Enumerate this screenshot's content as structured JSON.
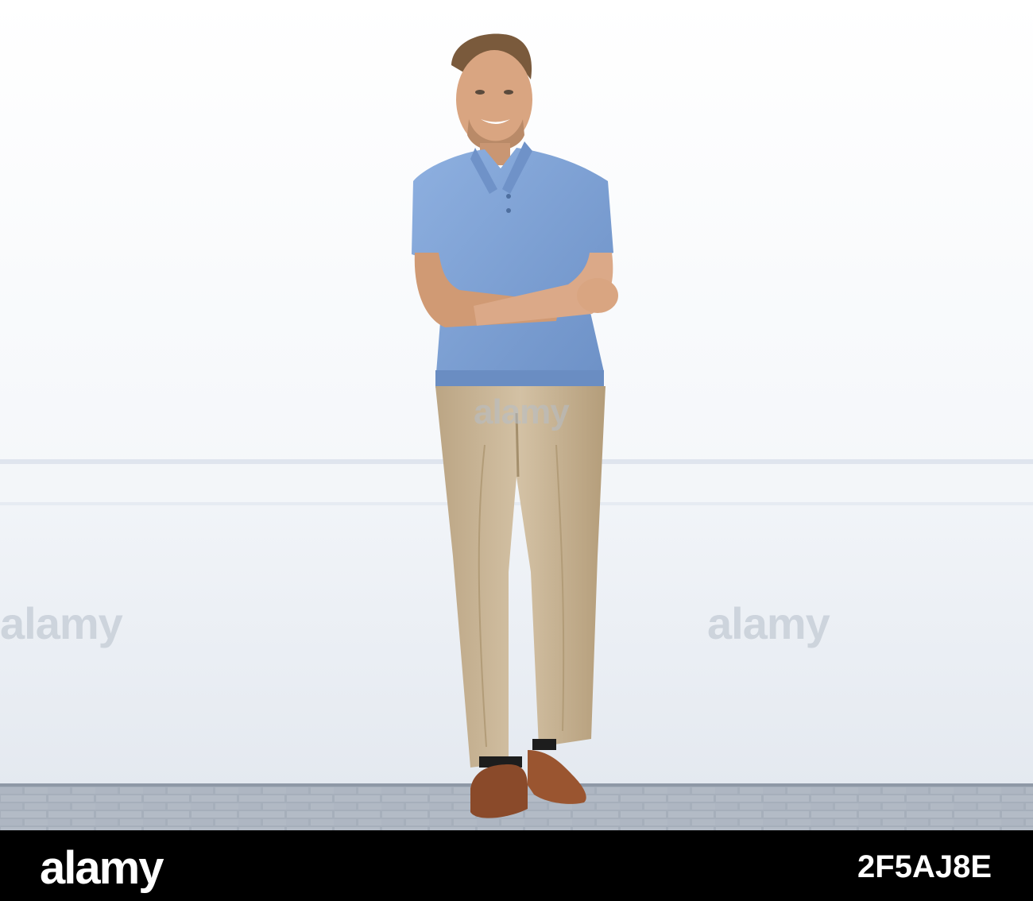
{
  "photo": {
    "subject": "man-leaning-on-wall",
    "colors": {
      "wall": "#f7f8fa",
      "shirt": "#7ea2d6",
      "trousers": "#c9b597",
      "shoes": "#8a4a2a",
      "pavement": "#9ea7b4",
      "skin": "#d9a581"
    }
  },
  "watermarks": {
    "center": "alamy",
    "left": "alamy",
    "right": "alamy"
  },
  "footer": {
    "logo": "alamy",
    "image_id": "2F5AJ8E"
  }
}
